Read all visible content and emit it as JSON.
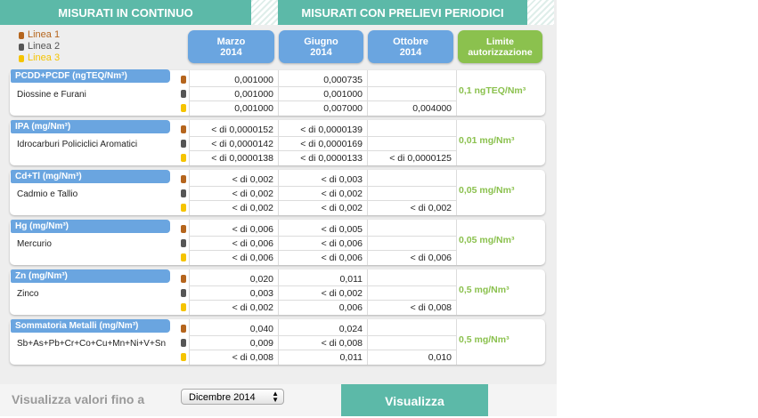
{
  "tabs": {
    "continuous": "MISURATI IN CONTINUO",
    "periodic": "MISURATI CON PRELIEVI PERIODICI"
  },
  "legend": [
    {
      "label": "Linea 1",
      "color": "#b5651d"
    },
    {
      "label": "Linea 2",
      "color": "#555555"
    },
    {
      "label": "Linea 3",
      "color": "#f5c400"
    }
  ],
  "columns": [
    {
      "line1": "Marzo",
      "line2": "2014"
    },
    {
      "line1": "Giugno",
      "line2": "2014"
    },
    {
      "line1": "Ottobre",
      "line2": "2014"
    },
    {
      "line1": "Limite",
      "line2": "autorizzazione"
    }
  ],
  "groups": [
    {
      "title": "PCDD+PCDF (ngTEQ/Nm³)",
      "name": "Diossine e Furani",
      "limit": "0,1 ngTEQ/Nm³",
      "rows": [
        [
          "0,001000",
          "0,000735",
          ""
        ],
        [
          "0,001000",
          "0,001000",
          ""
        ],
        [
          "0,001000",
          "0,007000",
          "0,004000"
        ]
      ]
    },
    {
      "title": "IPA (mg/Nm³)",
      "name": "Idrocarburi Policiclici Aromatici",
      "limit": "0,01 mg/Nm³",
      "rows": [
        [
          "< di 0,0000152",
          "< di 0,0000139",
          ""
        ],
        [
          "< di 0,0000142",
          "< di 0,0000169",
          ""
        ],
        [
          "< di 0,0000138",
          "< di 0,0000133",
          "< di 0,0000125"
        ]
      ]
    },
    {
      "title": "Cd+Tl (mg/Nm³)",
      "name": "Cadmio e Tallio",
      "limit": "0,05 mg/Nm³",
      "rows": [
        [
          "< di 0,002",
          "< di 0,003",
          ""
        ],
        [
          "< di 0,002",
          "< di 0,002",
          ""
        ],
        [
          "< di 0,002",
          "< di 0,002",
          "< di 0,002"
        ]
      ]
    },
    {
      "title": "Hg (mg/Nm³)",
      "name": "Mercurio",
      "limit": "0,05 mg/Nm³",
      "rows": [
        [
          "< di 0,006",
          "< di 0,005",
          ""
        ],
        [
          "< di 0,006",
          "< di 0,006",
          ""
        ],
        [
          "< di 0,006",
          "< di 0,006",
          "< di 0,006"
        ]
      ]
    },
    {
      "title": "Zn (mg/Nm³)",
      "name": "Zinco",
      "limit": "0,5 mg/Nm³",
      "rows": [
        [
          "0,020",
          "0,011",
          ""
        ],
        [
          "0,003",
          "< di 0,002",
          ""
        ],
        [
          "< di 0,002",
          "0,006",
          "< di 0,008"
        ]
      ]
    },
    {
      "title": "Sommatoria Metalli (mg/Nm³)",
      "name": "Sb+As+Pb+Cr+Co+Cu+Mn+Ni+V+Sn",
      "limit": "0,5 mg/Nm³",
      "rows": [
        [
          "0,040",
          "0,024",
          ""
        ],
        [
          "0,009",
          "< di 0,008",
          ""
        ],
        [
          "< di 0,008",
          "0,011",
          "0,010"
        ]
      ]
    }
  ],
  "footer": {
    "label": "Visualizza valori fino a",
    "select_value": "Dicembre 2014",
    "button": "Visualizza"
  },
  "colors": {
    "teal": "#5cb9a8",
    "blue": "#6aa5e0",
    "green": "#8bc14e"
  }
}
